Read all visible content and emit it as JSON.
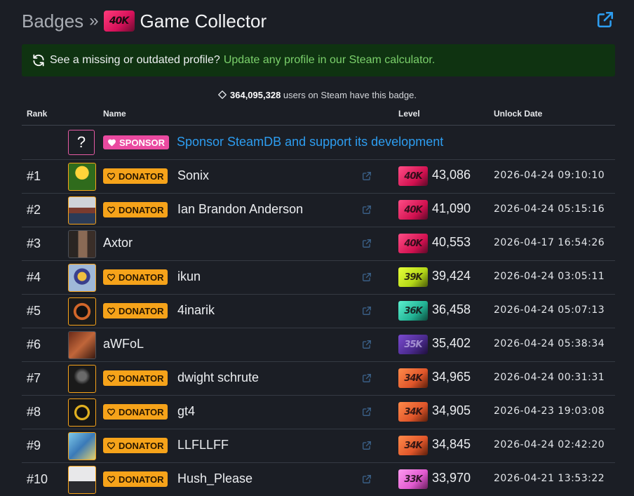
{
  "header": {
    "breadcrumb": "Badges",
    "separator": "»",
    "badge_glyph": "40K",
    "title": "Game Collector",
    "external_icon": "external-link-icon"
  },
  "banner": {
    "text": "See a missing or outdated profile?",
    "link": "Update any profile in our Steam calculator.",
    "icon": "refresh-icon"
  },
  "summary": {
    "count": "364,095,328",
    "text": "users on Steam have this badge.",
    "icon": "tag-icon"
  },
  "table": {
    "headers": {
      "rank": "Rank",
      "name": "Name",
      "level": "Level",
      "unlock": "Unlock Date"
    },
    "sponsor": {
      "avatar": "?",
      "tag": "SPONSOR",
      "link": "Sponsor SteamDB and support its development"
    },
    "donator_label": "DONATOR",
    "rows": [
      {
        "rank": "#1",
        "name": "Sonix",
        "donator": true,
        "badge": "40K",
        "badge_color": "#e8195f",
        "level": "43,086",
        "date": "2026-04-24 09:10:10"
      },
      {
        "rank": "#2",
        "name": "Ian Brandon Anderson",
        "donator": true,
        "badge": "40K",
        "badge_color": "#e8195f",
        "level": "41,090",
        "date": "2026-04-24 05:15:16"
      },
      {
        "rank": "#3",
        "name": "Axtor",
        "donator": false,
        "badge": "40K",
        "badge_color": "#e8195f",
        "level": "40,553",
        "date": "2026-04-17 16:54:26"
      },
      {
        "rank": "#4",
        "name": "ikun",
        "donator": true,
        "badge": "39K",
        "badge_color": "#c6e81c",
        "level": "39,424",
        "date": "2026-04-24 03:05:11"
      },
      {
        "rank": "#5",
        "name": "4inarik",
        "donator": true,
        "badge": "36K",
        "badge_color": "#2fc7a8",
        "level": "36,458",
        "date": "2026-04-24 05:07:13"
      },
      {
        "rank": "#6",
        "name": "aWFoL",
        "donator": false,
        "badge": "35K",
        "badge_color": "#4a2a8c",
        "level": "35,402",
        "date": "2026-04-24 05:38:34"
      },
      {
        "rank": "#7",
        "name": "dwight schrute",
        "donator": true,
        "badge": "34K",
        "badge_color": "#e8622a",
        "level": "34,965",
        "date": "2026-04-24 00:31:31"
      },
      {
        "rank": "#8",
        "name": "gt4",
        "donator": true,
        "badge": "34K",
        "badge_color": "#e8622a",
        "level": "34,905",
        "date": "2026-04-23 19:03:08"
      },
      {
        "rank": "#9",
        "name": "LLFLLFF",
        "donator": true,
        "badge": "34K",
        "badge_color": "#e8622a",
        "level": "34,845",
        "date": "2026-04-24 02:42:20"
      },
      {
        "rank": "#10",
        "name": "Hush_Please",
        "donator": true,
        "badge": "33K",
        "badge_color": "#e66fd8",
        "level": "33,970",
        "date": "2026-04-21 13:53:22"
      }
    ]
  },
  "colors": {
    "background": "#1b1e25",
    "banner_bg": "#0f3311",
    "banner_link": "#7bd06b",
    "link_blue": "#2d9df0",
    "donator": "#f6a31a",
    "sponsor": "#ea4aa0"
  }
}
